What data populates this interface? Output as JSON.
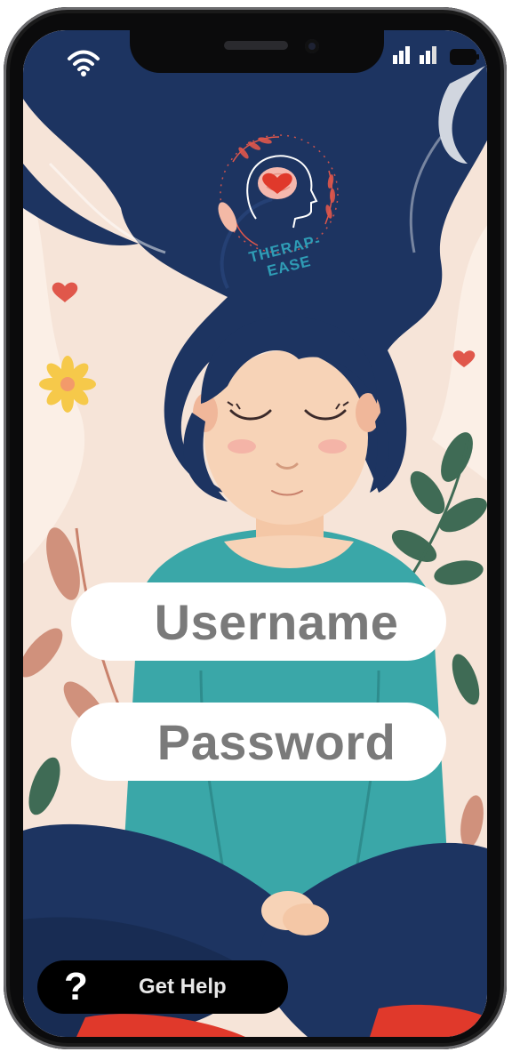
{
  "app": {
    "logo_text": "THERAP-EASE"
  },
  "status_bar": {
    "wifi_icon": "wifi-icon",
    "signal_icon": "signal-bars-icon",
    "battery_icon": "battery-icon"
  },
  "login": {
    "username_placeholder": "Username",
    "password_placeholder": "Password"
  },
  "help": {
    "icon": "question-mark-icon",
    "label": "Get Help"
  },
  "colors": {
    "hair": "#1d3461",
    "shirt": "#3aa7a8",
    "background": "#f6e4d8",
    "logo_accent": "#2f9db6",
    "heart": "#e0392b"
  }
}
